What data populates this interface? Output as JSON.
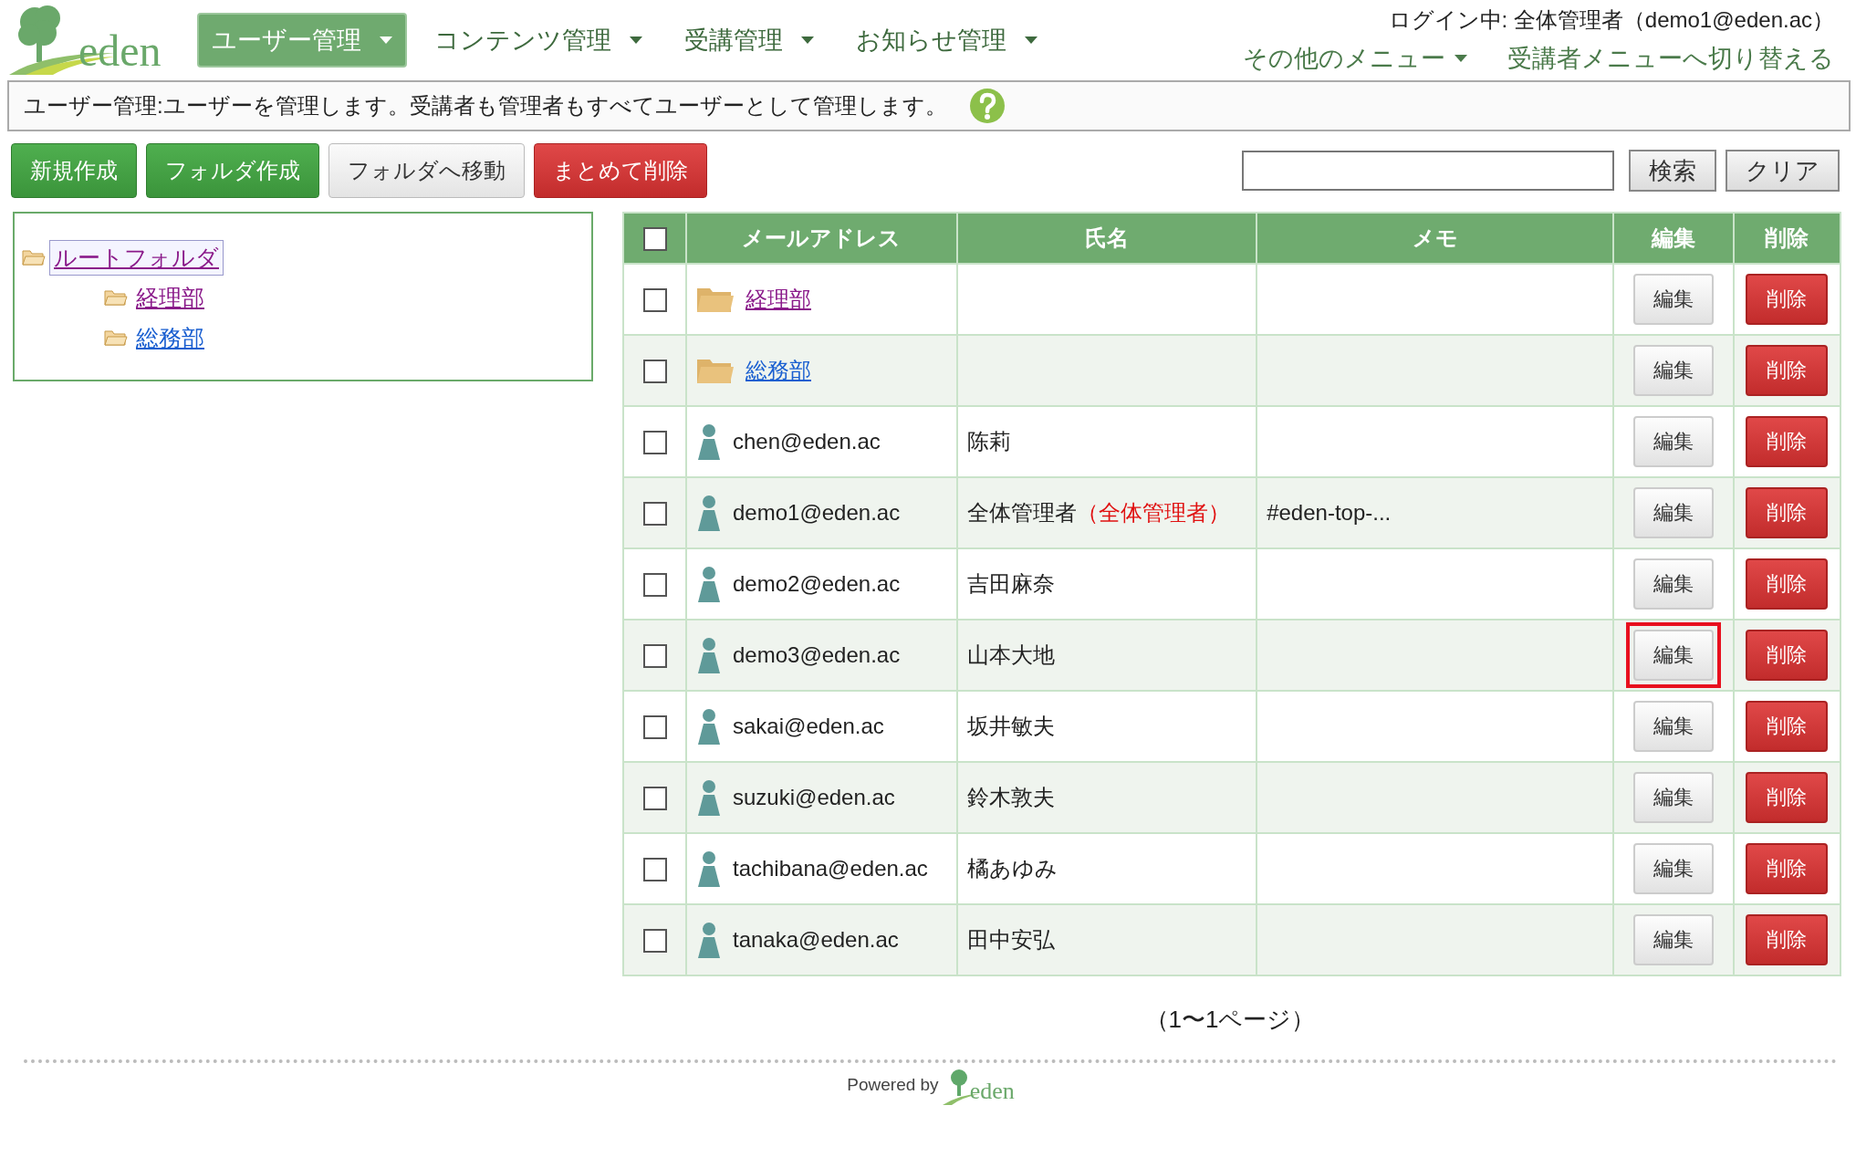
{
  "logo": {
    "text": "eden"
  },
  "nav": [
    {
      "label": "ユーザー管理",
      "selected": true
    },
    {
      "label": "コンテンツ管理",
      "selected": false
    },
    {
      "label": "受講管理",
      "selected": false
    },
    {
      "label": "お知らせ管理",
      "selected": false
    }
  ],
  "login": "ログイン中: 全体管理者（demo1@eden.ac）",
  "top_menu": [
    {
      "label": "その他のメニュー",
      "dropdown": true
    },
    {
      "label": "受講者メニューへ切り替える",
      "dropdown": false
    }
  ],
  "description": "ユーザー管理:ユーザーを管理します。受講者も管理者もすべてユーザーとして管理します。",
  "actions": [
    {
      "label": "新規作成",
      "kind": "primary"
    },
    {
      "label": "フォルダ作成",
      "kind": "primary"
    },
    {
      "label": "フォルダへ移動",
      "kind": "default"
    },
    {
      "label": "まとめて削除",
      "kind": "danger"
    }
  ],
  "search": {
    "button": "検索",
    "clear": "クリア"
  },
  "tree": [
    {
      "label": "ルートフォルダ",
      "selected": true,
      "visited": true,
      "children": [
        {
          "label": "経理部",
          "selected": false,
          "visited": true
        },
        {
          "label": "総務部",
          "selected": false,
          "visited": false
        }
      ]
    }
  ],
  "table": {
    "all_checked": false,
    "columns": [
      "メールアドレス",
      "氏名",
      "メモ",
      "編集",
      "削除"
    ],
    "rows": [
      {
        "kind": "folder",
        "email": "経理部",
        "visited": true,
        "checked": false,
        "highlighted": false,
        "edit": "編集",
        "delete": "削除"
      },
      {
        "kind": "folder",
        "email": "総務部",
        "visited": false,
        "checked": false,
        "highlighted": false,
        "edit": "編集",
        "delete": "削除"
      },
      {
        "kind": "user",
        "email": "chen@eden.ac",
        "name": "陈莉",
        "checked": false,
        "highlighted": false,
        "edit": "編集",
        "delete": "削除"
      },
      {
        "kind": "user",
        "email": "demo1@eden.ac",
        "name": "全体管理者",
        "role": "（全体管理者）",
        "memo": "#eden-top-...",
        "checked": false,
        "highlighted": false,
        "edit": "編集",
        "delete": "削除"
      },
      {
        "kind": "user",
        "email": "demo2@eden.ac",
        "name": "吉田麻奈",
        "checked": false,
        "highlighted": false,
        "edit": "編集",
        "delete": "削除"
      },
      {
        "kind": "user",
        "email": "demo3@eden.ac",
        "name": "山本大地",
        "checked": false,
        "highlighted": true,
        "edit": "編集",
        "delete": "削除"
      },
      {
        "kind": "user",
        "email": "sakai@eden.ac",
        "name": "坂井敏夫",
        "checked": false,
        "highlighted": false,
        "edit": "編集",
        "delete": "削除"
      },
      {
        "kind": "user",
        "email": "suzuki@eden.ac",
        "name": "鈴木敦夫",
        "checked": false,
        "highlighted": false,
        "edit": "編集",
        "delete": "削除"
      },
      {
        "kind": "user",
        "email": "tachibana@eden.ac",
        "name": "橘あゆみ",
        "checked": false,
        "highlighted": false,
        "edit": "編集",
        "delete": "削除"
      },
      {
        "kind": "user",
        "email": "tanaka@eden.ac",
        "name": "田中安弘",
        "checked": false,
        "highlighted": false,
        "edit": "編集",
        "delete": "削除"
      }
    ]
  },
  "pagination": "（1〜1ページ）",
  "footer": {
    "powered": "Powered by",
    "logo": "eden"
  }
}
